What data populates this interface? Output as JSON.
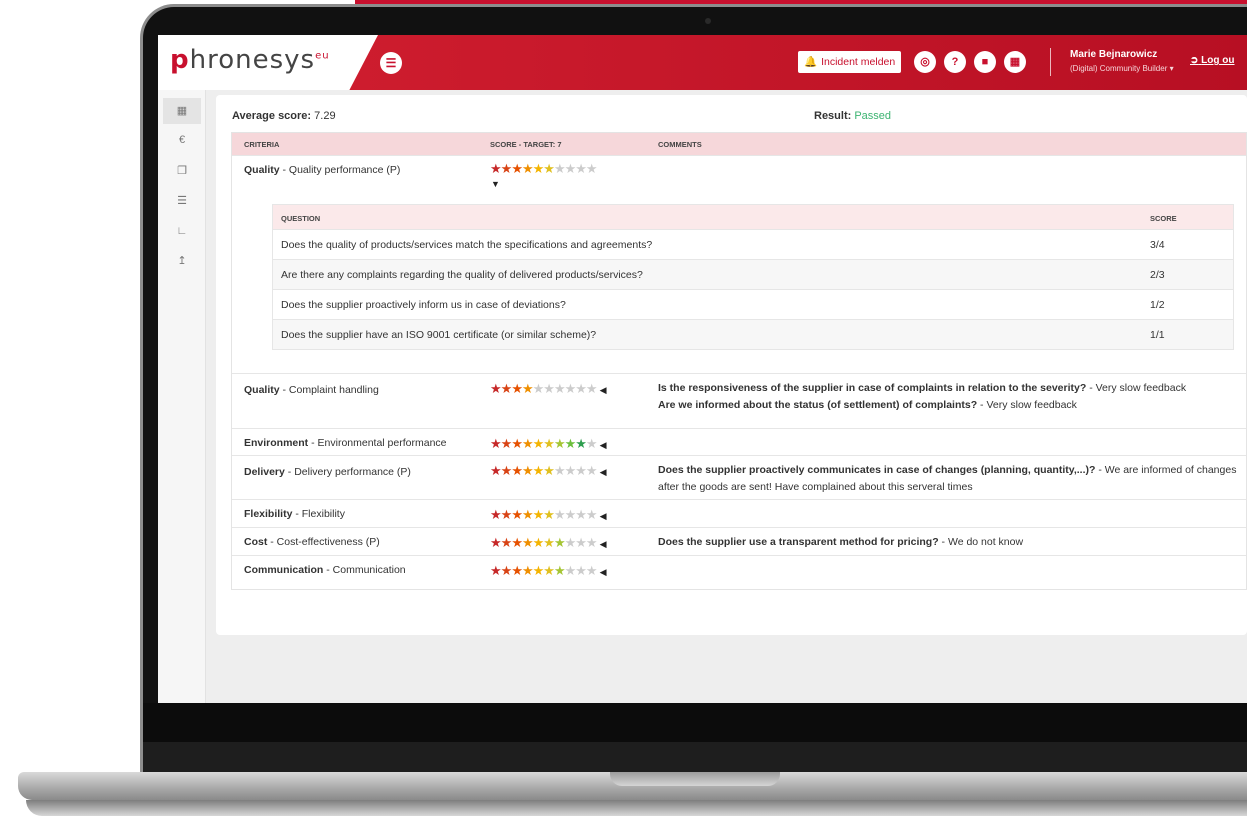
{
  "header": {
    "logo_text": "hronesys",
    "logo_letter": "p",
    "logo_suffix": "eu",
    "incident_label": "Incident melden",
    "user_name": "Marie Bejnarowicz",
    "user_role": "(Digital) Community Builder",
    "logout_label": "Log ou"
  },
  "summary": {
    "average_label": "Average score:",
    "average_value": "7.29",
    "result_label": "Result:",
    "result_value": "Passed"
  },
  "table": {
    "col_criteria": "CRITERIA",
    "col_score": "SCORE - TARGET: 7",
    "col_comments": "COMMENTS",
    "rows": [
      {
        "category": "Quality",
        "subcategory": " - Quality performance (P)",
        "score": 6,
        "expanded": true
      },
      {
        "category": "Quality",
        "subcategory": " - Complaint handling",
        "score": 4,
        "comments": [
          {
            "q": "Is the responsiveness of the supplier in case of complaints in relation to the severity?",
            "a": " - Very slow feedback"
          },
          {
            "q": "Are we informed about the status (of settlement) of complaints?",
            "a": " - Very slow feedback"
          }
        ]
      },
      {
        "category": "Environment",
        "subcategory": " - Environmental performance",
        "score": 9,
        "comments": []
      },
      {
        "category": "Delivery",
        "subcategory": " - Delivery performance (P)",
        "score": 6,
        "comments": [
          {
            "q": "Does the supplier proactively communicates in case of changes (planning, quantity,...)?",
            "a": " - We are informed of changes after the goods are sent! Have complained about this serveral times"
          }
        ]
      },
      {
        "category": "Flexibility",
        "subcategory": " - Flexibility",
        "score": 6,
        "comments": []
      },
      {
        "category": "Cost",
        "subcategory": " - Cost-effectiveness (P)",
        "score": 7,
        "comments": [
          {
            "q": "Does the supplier use a transparent method for pricing?",
            "a": " - We do not know"
          }
        ]
      },
      {
        "category": "Communication",
        "subcategory": " - Communication",
        "score": 7,
        "comments": []
      }
    ]
  },
  "questions": {
    "col_question": "QUESTION",
    "col_score": "SCORE",
    "rows": [
      {
        "question": "Does the quality of products/services match the specifications and agreements?",
        "score": "3/4"
      },
      {
        "question": "Are there any complaints regarding the quality of delivered products/services?",
        "score": "2/3"
      },
      {
        "question": "Does the supplier proactively inform us in case of deviations?",
        "score": "1/2"
      },
      {
        "question": "Does the supplier have an ISO 9001 certificate (or similar scheme)?",
        "score": "1/1"
      }
    ]
  },
  "stars": {
    "max": 10
  },
  "colors": {
    "brand": "#c8102e",
    "passed": "#3cb371",
    "star_scale": [
      "#c62828",
      "#d84315",
      "#e65100",
      "#ef8f00",
      "#f4b400",
      "#e0c020",
      "#a5c534",
      "#6cbf3c",
      "#2e9e4f",
      "#1f8a45"
    ],
    "star_empty": "#cccccc"
  },
  "icons": {
    "sidebar": [
      "dashboard-icon",
      "euro-icon",
      "documents-icon",
      "list-icon",
      "chart-icon",
      "upload-icon"
    ],
    "header": [
      "menu-icon",
      "bell-icon",
      "headset-icon",
      "help-icon",
      "video-icon",
      "calendar-icon"
    ]
  }
}
